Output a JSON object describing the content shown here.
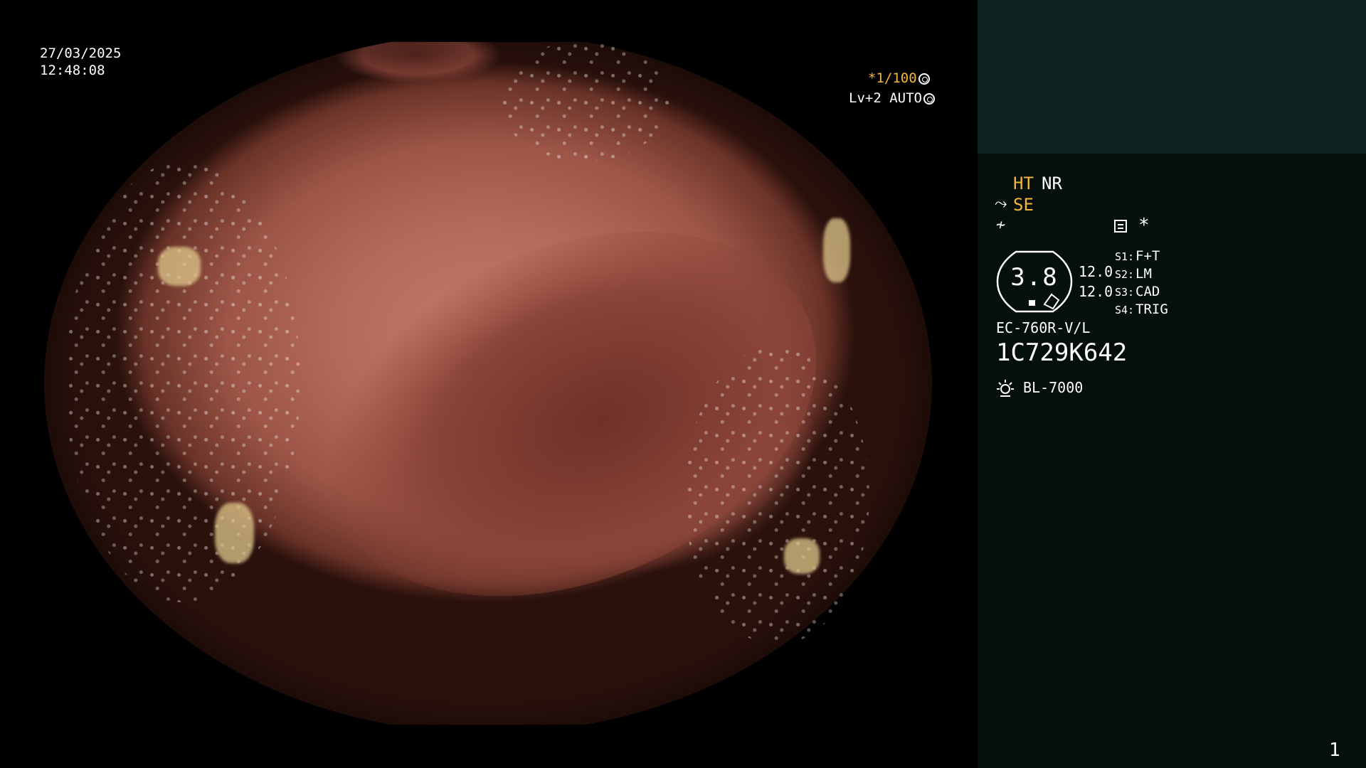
{
  "overlay": {
    "date": "27/03/2025",
    "time": "12:48:08",
    "shutter": "*1/100",
    "level": "Lv+2 AUTO"
  },
  "panel": {
    "ht_label": "HT",
    "nr_label": "NR",
    "se_label": "SE",
    "se_icon": "⤳",
    "enhance_icon": "≁",
    "star": "*",
    "gauge_value": "3.8",
    "value1": "12.0",
    "value2": "12.0",
    "switches": [
      {
        "key": "S1:",
        "value": "F+T"
      },
      {
        "key": "S2:",
        "value": "LM"
      },
      {
        "key": "S3:",
        "value": "CAD"
      },
      {
        "key": "S4:",
        "value": "TRIG"
      }
    ],
    "scope_model": "EC-760R-V/L",
    "scope_serial": "1C729K642",
    "light_source": "BL-7000"
  },
  "page_number": "1",
  "colors": {
    "accent_yellow": "#f4b53a",
    "panel_bg": "#050f0e",
    "panel_top_bg": "#0f2422"
  }
}
